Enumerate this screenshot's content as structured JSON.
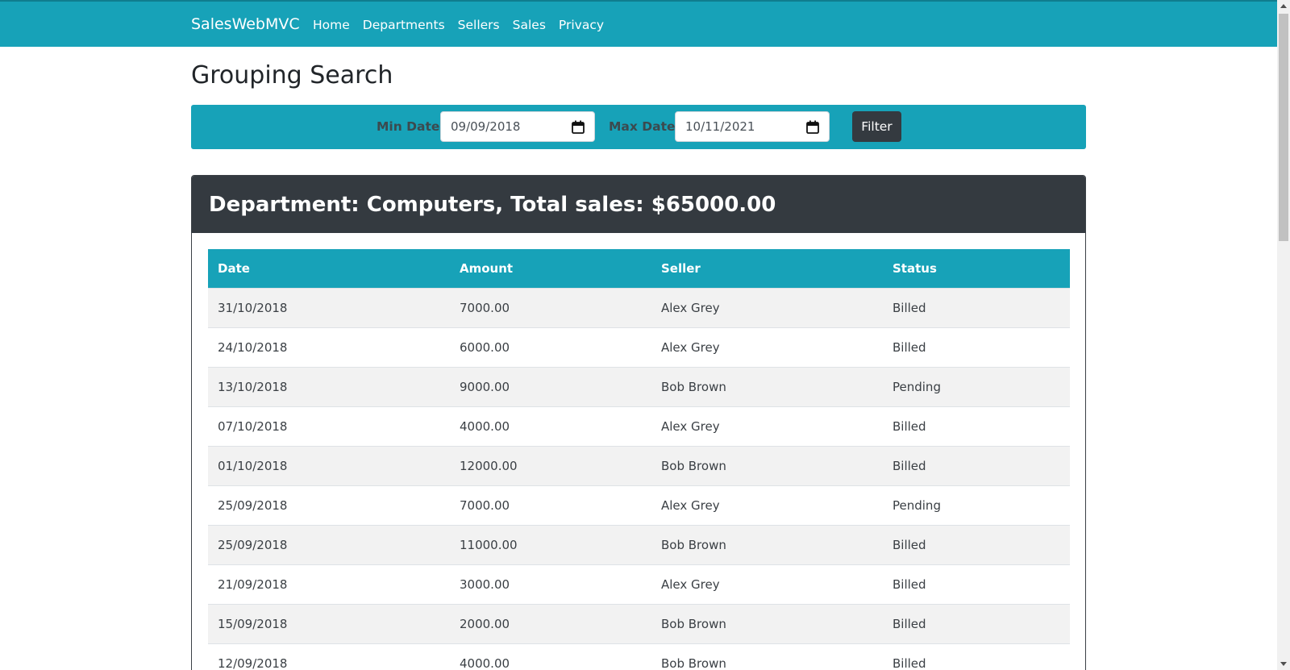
{
  "nav": {
    "brand": "SalesWebMVC",
    "links": [
      "Home",
      "Departments",
      "Sellers",
      "Sales",
      "Privacy"
    ]
  },
  "page": {
    "title": "Grouping Search"
  },
  "filter": {
    "min_label": "Min Date",
    "min_value": "09/09/2018",
    "max_label": "Max Date",
    "max_value": "10/11/2021",
    "button": "Filter"
  },
  "department": {
    "header": "Department: Computers, Total sales: $65000.00",
    "columns": [
      "Date",
      "Amount",
      "Seller",
      "Status"
    ],
    "rows": [
      [
        "31/10/2018",
        "7000.00",
        "Alex Grey",
        "Billed"
      ],
      [
        "24/10/2018",
        "6000.00",
        "Alex Grey",
        "Billed"
      ],
      [
        "13/10/2018",
        "9000.00",
        "Bob Brown",
        "Pending"
      ],
      [
        "07/10/2018",
        "4000.00",
        "Alex Grey",
        "Billed"
      ],
      [
        "01/10/2018",
        "12000.00",
        "Bob Brown",
        "Billed"
      ],
      [
        "25/09/2018",
        "7000.00",
        "Alex Grey",
        "Pending"
      ],
      [
        "25/09/2018",
        "11000.00",
        "Bob Brown",
        "Billed"
      ],
      [
        "21/09/2018",
        "3000.00",
        "Alex Grey",
        "Billed"
      ],
      [
        "15/09/2018",
        "2000.00",
        "Bob Brown",
        "Billed"
      ],
      [
        "12/09/2018",
        "4000.00",
        "Bob Brown",
        "Billed"
      ]
    ]
  },
  "icons": {
    "date_picker": "calendar-icon"
  },
  "colors": {
    "accent": "#17a2b8",
    "dark": "#343a40",
    "stripe": "#f2f2f2"
  }
}
